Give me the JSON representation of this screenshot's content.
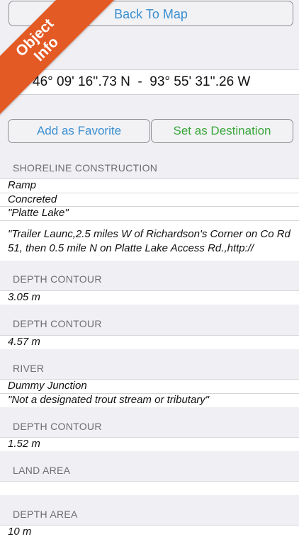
{
  "header": {
    "back_label": "Back To Map",
    "coordinates": "46° 09' 16''.73 N  -  93° 55' 31''.26 W"
  },
  "actions": {
    "favorite_label": "Add as Favorite",
    "destination_label": "Set as Destination"
  },
  "ribbon": {
    "line1": "Object",
    "line2": "Info",
    "color": "#e45a25"
  },
  "colors": {
    "link_blue": "#3a8fd0",
    "link_green": "#3aa63a"
  },
  "sections": [
    {
      "title": "SHORELINE CONSTRUCTION",
      "rows": [
        "Ramp",
        "Concreted",
        "\"Platte Lake\"",
        "\"Trailer Launc,2.5 miles W of Richardson's Corner on Co Rd 51, then 0.5 mile N on Platte Lake Access Rd.,http://"
      ]
    },
    {
      "title": "DEPTH CONTOUR",
      "rows": [
        "3.05 m"
      ]
    },
    {
      "title": "DEPTH CONTOUR",
      "rows": [
        "4.57 m"
      ]
    },
    {
      "title": "RIVER",
      "rows": [
        "Dummy Junction",
        "\"Not a designated trout stream or tributary\""
      ]
    },
    {
      "title": "DEPTH CONTOUR",
      "rows": [
        "1.52 m"
      ]
    },
    {
      "title": "LAND AREA",
      "rows": [
        ""
      ]
    },
    {
      "title": "DEPTH AREA",
      "rows": [
        "10 m"
      ]
    }
  ]
}
